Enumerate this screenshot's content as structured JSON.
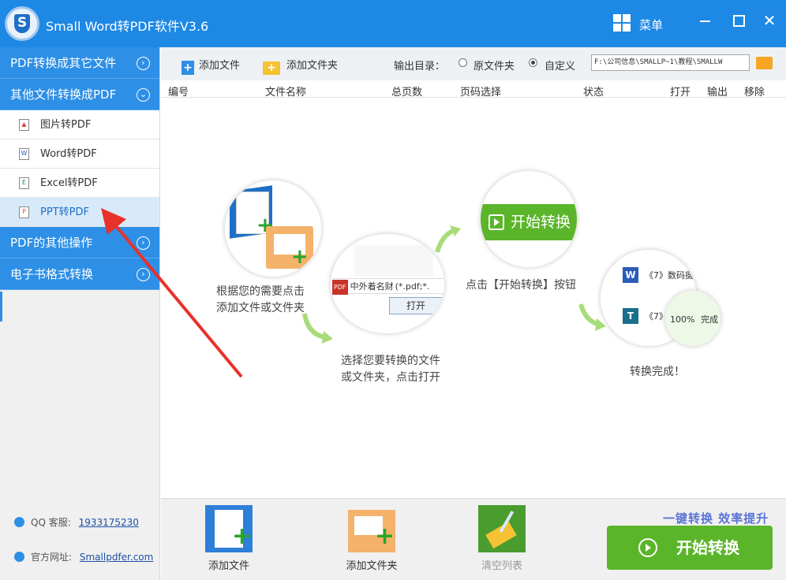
{
  "window": {
    "title": "Small  Word转PDF软件V3.6",
    "logo_letter": "S",
    "menu_label": "菜单",
    "close_glyph": "✕"
  },
  "sidebar": {
    "categories": [
      {
        "label": "PDF转换成其它文件",
        "chevron": "›"
      },
      {
        "label": "其他文件转换成PDF",
        "chevron": "⌄"
      },
      {
        "label": "PDF的其他操作",
        "chevron": "›"
      },
      {
        "label": "电子书格式转换",
        "chevron": "›"
      }
    ],
    "items": [
      {
        "label": "图片转PDF",
        "icon": "image-file-icon",
        "glyph": "▲"
      },
      {
        "label": "Word转PDF",
        "icon": "word-file-icon",
        "glyph": "W"
      },
      {
        "label": "Excel转PDF",
        "icon": "excel-file-icon",
        "glyph": "E"
      },
      {
        "label": "PPT转PDF",
        "icon": "ppt-file-icon",
        "glyph": "P"
      }
    ],
    "qq_label": "QQ 客服:",
    "qq_number": "1933175230",
    "site_label": "官方网址:",
    "site_url": "Smallpdfer.com"
  },
  "toolbar": {
    "add_file": "添加文件",
    "add_folder": "添加文件夹",
    "output_label": "输出目录：",
    "option_original": "原文件夹",
    "option_custom": "自定义",
    "output_path": "F:\\公司信息\\SMALLP~1\\教程\\SMALLW",
    "selected_option": "自定义"
  },
  "table": {
    "columns": [
      "编号",
      "文件名称",
      "总页数",
      "页码选择",
      "状态",
      "打开",
      "输出",
      "移除"
    ]
  },
  "guide": {
    "step1": [
      "根据您的需要点击",
      "添加文件或文件夹"
    ],
    "step2": [
      "选择您要转换的文件",
      "或文件夹，点击打开"
    ],
    "step2_file": "中外着名财",
    "step2_filter": "(*.pdf;*.",
    "step2_open": "打开",
    "step3": "点击【开始转换】按钮",
    "step3_button": "开始转换",
    "step4": "转换完成！",
    "step4_row1": "《7》数码摄",
    "step4_row2": "《7》",
    "step4_progress": "100%",
    "step4_status": "完成"
  },
  "bottom": {
    "add_file": "添加文件",
    "add_folder": "添加文件夹",
    "clear_list": "清空列表",
    "slogan": "一键转换  效率提升",
    "start": "开始转换"
  },
  "colors": {
    "titlebar": "#1e88e5",
    "sidebar_category": "#2d8fe6",
    "start_button": "#5bb52a",
    "slogan": "#5a74d6",
    "annotation_arrow": "#e8312a"
  }
}
